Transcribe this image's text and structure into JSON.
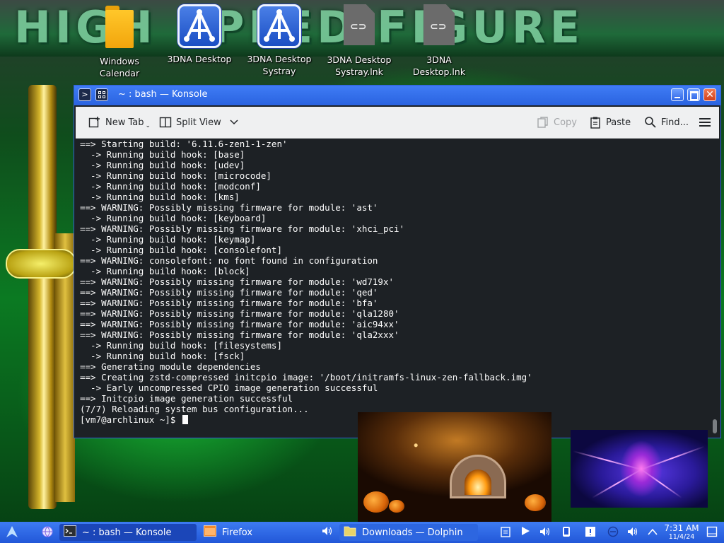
{
  "desktop": {
    "wallpaper_text": "HIGH SPEED FIGURE",
    "icons": [
      {
        "label": "Windows Calendar",
        "kind": "folder"
      },
      {
        "label": "3DNA Desktop",
        "kind": "app"
      },
      {
        "label": "3DNA Desktop Systray",
        "kind": "app"
      },
      {
        "label": "3DNA Desktop Systray.lnk",
        "kind": "link"
      },
      {
        "label": "3DNA Desktop.lnk",
        "kind": "link"
      }
    ]
  },
  "window": {
    "title": "~ : bash — Konsole",
    "toolbar": {
      "new_tab": "New Tab",
      "split_view": "Split View",
      "copy": "Copy",
      "paste": "Paste",
      "find": "Find..."
    },
    "terminal_lines": [
      "==> Starting build: '6.11.6-zen1-1-zen'",
      "  -> Running build hook: [base]",
      "  -> Running build hook: [udev]",
      "  -> Running build hook: [microcode]",
      "  -> Running build hook: [modconf]",
      "  -> Running build hook: [kms]",
      "==> WARNING: Possibly missing firmware for module: 'ast'",
      "  -> Running build hook: [keyboard]",
      "==> WARNING: Possibly missing firmware for module: 'xhci_pci'",
      "  -> Running build hook: [keymap]",
      "  -> Running build hook: [consolefont]",
      "==> WARNING: consolefont: no font found in configuration",
      "  -> Running build hook: [block]",
      "==> WARNING: Possibly missing firmware for module: 'wd719x'",
      "==> WARNING: Possibly missing firmware for module: 'qed'",
      "==> WARNING: Possibly missing firmware for module: 'bfa'",
      "==> WARNING: Possibly missing firmware for module: 'qla1280'",
      "==> WARNING: Possibly missing firmware for module: 'aic94xx'",
      "==> WARNING: Possibly missing firmware for module: 'qla2xxx'",
      "  -> Running build hook: [filesystems]",
      "  -> Running build hook: [fsck]",
      "==> Generating module dependencies",
      "==> Creating zstd-compressed initcpio image: '/boot/initramfs-linux-zen-fallback.img'",
      "  -> Early uncompressed CPIO image generation successful",
      "==> Initcpio image generation successful",
      "(7/7) Reloading system bus configuration..."
    ],
    "prompt": "[vm7@archlinux ~]$"
  },
  "taskbar": {
    "tasks": [
      {
        "label": "~ : bash — Konsole",
        "active": true
      },
      {
        "label": "Firefox",
        "active": false
      },
      {
        "label": "Downloads — Dolphin",
        "active": false
      }
    ],
    "clock_time": "7:31 AM",
    "clock_date": "11/4/24"
  },
  "colors": {
    "titlebar": "#2a63e0",
    "taskbar": "#2257d8",
    "terminal_bg": "#1d2125",
    "terminal_fg": "#fcfcfc"
  }
}
